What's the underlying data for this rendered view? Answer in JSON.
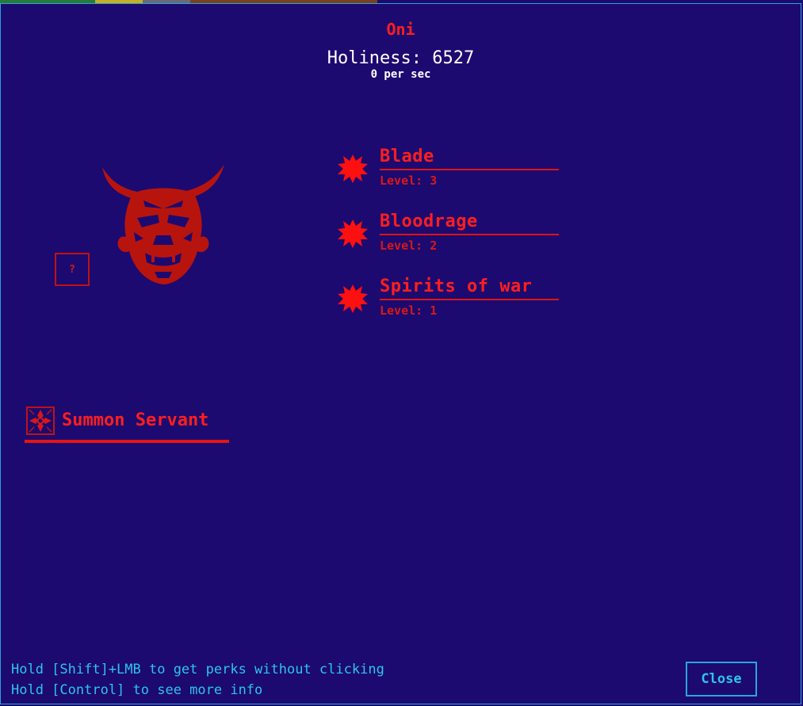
{
  "window": {
    "title": "Oni",
    "holiness": "Holiness: 6527",
    "per_sec": "0 per sec"
  },
  "god": {
    "name": "oni",
    "icon": "oni-mask-icon",
    "help_label": "?"
  },
  "perks": [
    {
      "name": "Blade",
      "level": "Level: 3",
      "icon": "burst-icon"
    },
    {
      "name": "Bloodrage",
      "level": "Level: 2",
      "icon": "burst-icon"
    },
    {
      "name": "Spirits of war",
      "level": "Level: 1",
      "icon": "burst-icon"
    }
  ],
  "summon": {
    "label": "Summon Servant",
    "icon": "cross-emblem-icon"
  },
  "hints": [
    "Hold [Shift]+LMB to get perks without clicking",
    "Hold [Control] to see more info"
  ],
  "close_label": "Close",
  "colors": {
    "background": "#1c0a70",
    "accent_red": "#ff1e1e",
    "border_cyan": "#2aa6d8",
    "hint_cyan": "#2ec4e8"
  }
}
